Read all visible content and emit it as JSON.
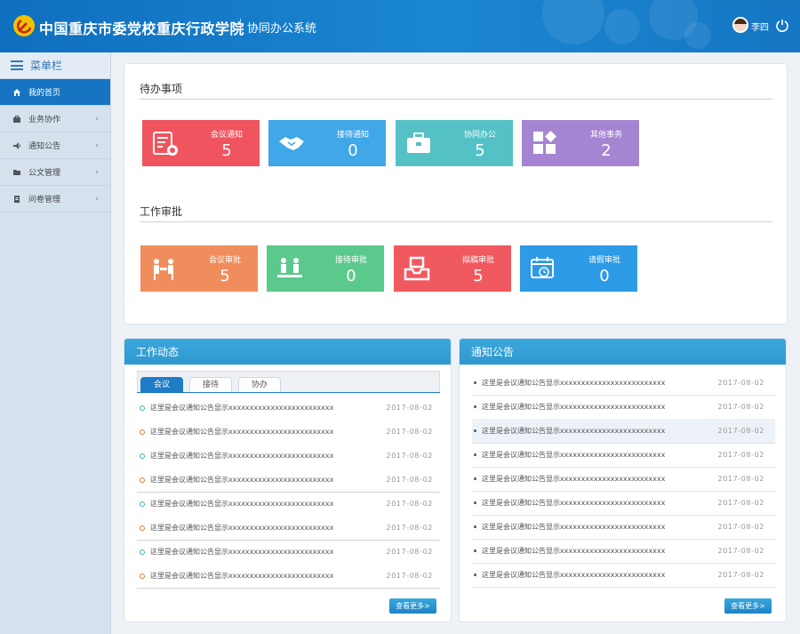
{
  "header": {
    "brand": "中国重庆市委党校重庆行政学院",
    "subtitle": "协同办公系统",
    "username": "李四"
  },
  "sidebar": {
    "title": "菜单栏",
    "items": [
      {
        "label": "我的首页",
        "icon": "home-icon",
        "active": true
      },
      {
        "label": "业务协作",
        "icon": "briefcase-icon",
        "active": false
      },
      {
        "label": "通知公告",
        "icon": "megaphone-icon",
        "active": false
      },
      {
        "label": "公文管理",
        "icon": "folder-icon",
        "active": false
      },
      {
        "label": "问卷管理",
        "icon": "document-icon",
        "active": false
      }
    ]
  },
  "todo": {
    "title": "待办事项",
    "tiles": [
      {
        "label": "会议通知",
        "count": "5",
        "color": "#f0545f",
        "icon": "meeting-notice-icon"
      },
      {
        "label": "接待通知",
        "count": "0",
        "color": "#40a7e8",
        "icon": "handshake-icon"
      },
      {
        "label": "协同办公",
        "count": "5",
        "color": "#54c1c6",
        "icon": "toolbox-icon"
      },
      {
        "label": "其他事务",
        "count": "2",
        "color": "#a585d1",
        "icon": "grid-icon"
      }
    ]
  },
  "approval": {
    "title": "工作审批",
    "tiles": [
      {
        "label": "会议审批",
        "count": "5",
        "color": "#f08d5c",
        "icon": "conference-icon"
      },
      {
        "label": "接待审批",
        "count": "0",
        "color": "#5bc98b",
        "icon": "reception-icon"
      },
      {
        "label": "拟稿审批",
        "count": "5",
        "color": "#f0595f",
        "icon": "inbox-icon"
      },
      {
        "label": "请假审批",
        "count": "0",
        "color": "#2d9be6",
        "icon": "calendar-clock-icon"
      }
    ]
  },
  "work_panel": {
    "title": "工作动态",
    "tabs": [
      "会议",
      "接待",
      "协办"
    ],
    "rows": [
      {
        "text": "这里是会议通知公告显示xxxxxxxxxxxxxxxxxxxxxxxxx",
        "date": "2017-08-02",
        "dot": "teal"
      },
      {
        "text": "这里是会议通知公告显示xxxxxxxxxxxxxxxxxxxxxxxxx",
        "date": "2017-08-02",
        "dot": "orange"
      },
      {
        "text": "这里是会议通知公告显示xxxxxxxxxxxxxxxxxxxxxxxxx",
        "date": "2017-08-02",
        "dot": "teal"
      },
      {
        "text": "这里是会议通知公告显示xxxxxxxxxxxxxxxxxxxxxxxxx",
        "date": "2017-08-02",
        "dot": "orange"
      },
      {
        "text": "这里是会议通知公告显示xxxxxxxxxxxxxxxxxxxxxxxxx",
        "date": "2017-08-02",
        "dot": "teal"
      },
      {
        "text": "这里是会议通知公告显示xxxxxxxxxxxxxxxxxxxxxxxxx",
        "date": "2017-08-02",
        "dot": "orange"
      },
      {
        "text": "这里是会议通知公告显示xxxxxxxxxxxxxxxxxxxxxxxxx",
        "date": "2017-08-02",
        "dot": "teal"
      },
      {
        "text": "这里是会议通知公告显示xxxxxxxxxxxxxxxxxxxxxxxxx",
        "date": "2017-08-02",
        "dot": "orange"
      }
    ],
    "more_label": "查看更多>"
  },
  "notice_panel": {
    "title": "通知公告",
    "rows": [
      {
        "text": "这里是会议通知公告显示xxxxxxxxxxxxxxxxxxxxxxxxx",
        "date": "2017-08-02"
      },
      {
        "text": "这里是会议通知公告显示xxxxxxxxxxxxxxxxxxxxxxxxx",
        "date": "2017-08-02"
      },
      {
        "text": "这里是会议通知公告显示xxxxxxxxxxxxxxxxxxxxxxxxx",
        "date": "2017-08-02",
        "highlight": true
      },
      {
        "text": "这里是会议通知公告显示xxxxxxxxxxxxxxxxxxxxxxxxx",
        "date": "2017-08-02"
      },
      {
        "text": "这里是会议通知公告显示xxxxxxxxxxxxxxxxxxxxxxxxx",
        "date": "2017-08-02"
      },
      {
        "text": "这里是会议通知公告显示xxxxxxxxxxxxxxxxxxxxxxxxx",
        "date": "2017-08-02"
      },
      {
        "text": "这里是会议通知公告显示xxxxxxxxxxxxxxxxxxxxxxxxx",
        "date": "2017-08-02"
      },
      {
        "text": "这里是会议通知公告显示xxxxxxxxxxxxxxxxxxxxxxxxx",
        "date": "2017-08-02"
      },
      {
        "text": "这里是会议通知公告显示xxxxxxxxxxxxxxxxxxxxxxxxx",
        "date": "2017-08-02"
      }
    ],
    "more_label": "查看更多>"
  }
}
